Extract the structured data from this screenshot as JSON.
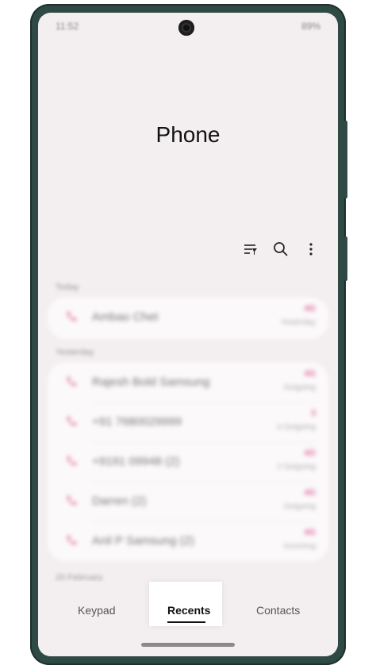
{
  "status_bar": {
    "time": "11:52",
    "battery": "89%"
  },
  "app": {
    "title": "Phone"
  },
  "toolbar": {
    "filter_icon": "filter-icon",
    "search_icon": "search-icon",
    "more_icon": "more-vert-icon"
  },
  "sections": [
    {
      "header": "Today",
      "items": [
        {
          "name": "Ambao Chet",
          "badge": "4G",
          "sub": "Yesterday"
        }
      ]
    },
    {
      "header": "Yesterday",
      "items": [
        {
          "name": "Rajesh Bold Samsung",
          "badge": "4G",
          "sub": "Outgoing"
        },
        {
          "name": "+91 7680029999",
          "badge": "3",
          "sub": "4 Outgoing"
        },
        {
          "name": "+9191 09948 (2)",
          "badge": "4G",
          "sub": "2 Outgoing"
        },
        {
          "name": "Darren (2)",
          "badge": "4G",
          "sub": "Outgoing"
        },
        {
          "name": "Anil P Samsung (2)",
          "badge": "4G",
          "sub": "Incoming"
        }
      ]
    },
    {
      "header": "20 February",
      "items": []
    }
  ],
  "bottom_nav": [
    {
      "label": "Keypad",
      "active": false
    },
    {
      "label": "Recents",
      "active": true
    },
    {
      "label": "Contacts",
      "active": false
    }
  ],
  "colors": {
    "accent": "#e16aa1",
    "screen_bg": "#f3eff0",
    "frame": "#2f4a44"
  }
}
